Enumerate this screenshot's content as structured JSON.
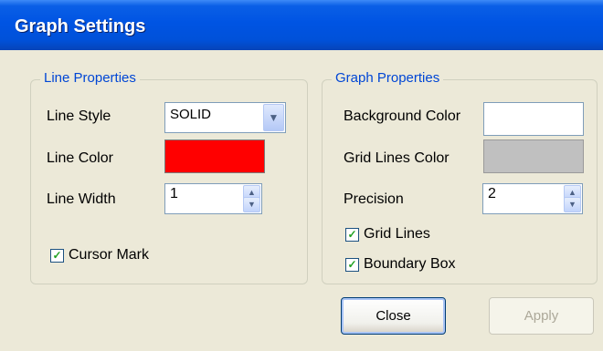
{
  "window": {
    "title": "Graph Settings"
  },
  "line_properties": {
    "title": "Line Properties",
    "line_style": {
      "label": "Line Style",
      "value": "SOLID"
    },
    "line_color": {
      "label": "Line Color",
      "color": "#ff0000"
    },
    "line_width": {
      "label": "Line Width",
      "value": "1"
    },
    "cursor_mark": {
      "label": "Cursor Mark",
      "checked": true
    }
  },
  "graph_properties": {
    "title": "Graph Properties",
    "background_color": {
      "label": "Background Color",
      "color": "#ffffff"
    },
    "grid_lines_color": {
      "label": "Grid Lines Color",
      "color": "#c0c0c0"
    },
    "precision": {
      "label": "Precision",
      "value": "2"
    },
    "grid_lines": {
      "label": "Grid Lines",
      "checked": true
    },
    "boundary_box": {
      "label": "Boundary Box",
      "checked": true
    }
  },
  "buttons": {
    "close": "Close",
    "apply": "Apply"
  },
  "icons": {
    "dropdown": "chevron-down-icon",
    "spin_up": "triangle-up-icon",
    "spin_down": "triangle-down-icon",
    "check": "checkmark-icon"
  }
}
